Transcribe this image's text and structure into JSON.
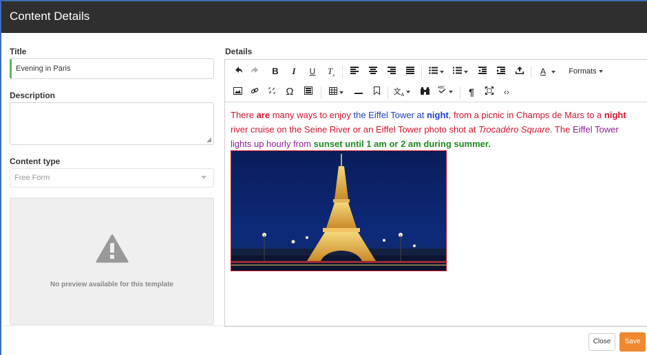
{
  "header": {
    "title": "Content Details"
  },
  "form": {
    "title_label": "Title",
    "title_value": "Evening in Paris",
    "description_label": "Description",
    "description_value": "",
    "content_type_label": "Content type",
    "content_type_value": "Free Form",
    "preview_message": "No preview available for this template"
  },
  "details": {
    "label": "Details",
    "toolbar": {
      "row1": [
        "undo-icon",
        "redo-icon",
        "bold-icon",
        "italic-icon",
        "underline-icon",
        "clear-formatting-icon",
        "align-left-icon",
        "align-center-icon",
        "align-right-icon",
        "justify-icon",
        "bullet-list-icon",
        "numbered-list-icon",
        "outdent-icon",
        "indent-icon",
        "upload-icon",
        "text-color-icon"
      ],
      "formats_label": "Formats",
      "row2": [
        "image-icon",
        "link-icon",
        "unlink-icon",
        "special-char-icon",
        "media-icon",
        "table-icon",
        "horizontal-rule-icon",
        "bookmark-icon",
        "translate-icon",
        "find-icon",
        "spellcheck-icon",
        "paragraph-mark-icon",
        "fullscreen-icon",
        "source-code-icon"
      ]
    },
    "content": {
      "s1": "There ",
      "s2": "are",
      "s3": " many ways to enjoy ",
      "s4": "the Eiffel Tower at ",
      "s5": "night",
      "s6": ", from a picnic in Champs de Mars to a ",
      "s7": "night",
      "s8": " river cruise on the Seine River or an Eiffel Tower photo shot at ",
      "s9": "Trocadéro Square",
      "s10": ". The ",
      "s11": "Eiffel Tower lights up hourly from ",
      "s12": "sunset until 1 am or 2 am during summer."
    },
    "image": {
      "subject": "Eiffel Tower at night"
    }
  },
  "footer": {
    "close_label": "Close",
    "save_label": "Save"
  },
  "colors": {
    "header_bg": "#2f2f2f",
    "save": "#f0882e",
    "valid_bar": "#5cb85c",
    "text_red": "#d0132b",
    "text_blue": "#1c3fc1",
    "text_purple": "#8a1f8f",
    "text_green": "#1f8a1f"
  }
}
